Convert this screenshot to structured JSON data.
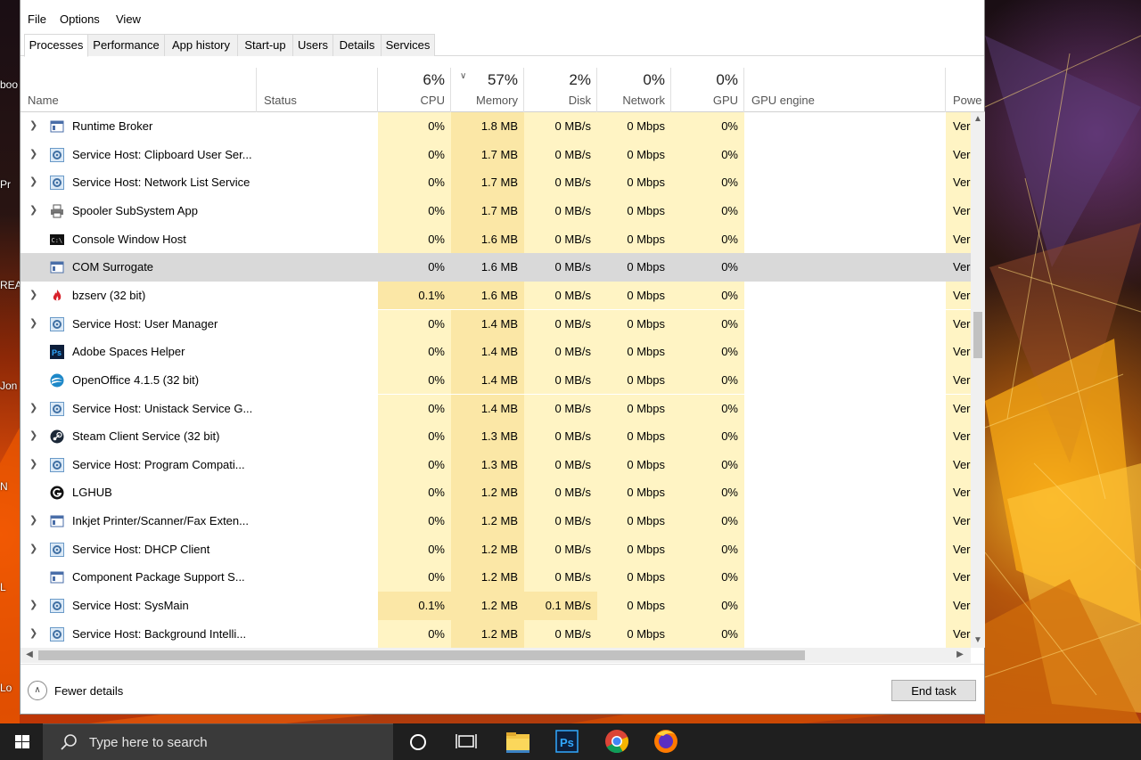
{
  "menu": [
    "File",
    "Options",
    "View"
  ],
  "tabs": [
    "Processes",
    "Performance",
    "App history",
    "Start-up",
    "Users",
    "Details",
    "Services"
  ],
  "header": {
    "name": "Name",
    "status": "Status",
    "cpu": {
      "pct": "6%",
      "label": "CPU"
    },
    "memory": {
      "pct": "57%",
      "label": "Memory"
    },
    "disk": {
      "pct": "2%",
      "label": "Disk"
    },
    "network": {
      "pct": "0%",
      "label": "Network"
    },
    "gpu": {
      "pct": "0%",
      "label": "GPU"
    },
    "gpu_engine": "GPU engine",
    "power": "Powe"
  },
  "processes": [
    {
      "name": "Runtime Broker",
      "icon": "window-icon",
      "expand": true,
      "cpu": "0%",
      "mem": "1.8 MB",
      "disk": "0 MB/s",
      "net": "0 Mbps",
      "gpu": "0%",
      "power": "Ver"
    },
    {
      "name": "Service Host: Clipboard User Ser...",
      "icon": "gear-icon",
      "expand": true,
      "cpu": "0%",
      "mem": "1.7 MB",
      "disk": "0 MB/s",
      "net": "0 Mbps",
      "gpu": "0%",
      "power": "Ver"
    },
    {
      "name": "Service Host: Network List Service",
      "icon": "gear-icon",
      "expand": true,
      "cpu": "0%",
      "mem": "1.7 MB",
      "disk": "0 MB/s",
      "net": "0 Mbps",
      "gpu": "0%",
      "power": "Ver"
    },
    {
      "name": "Spooler SubSystem App",
      "icon": "printer-icon",
      "expand": true,
      "cpu": "0%",
      "mem": "1.7 MB",
      "disk": "0 MB/s",
      "net": "0 Mbps",
      "gpu": "0%",
      "power": "Ver"
    },
    {
      "name": "Console Window Host",
      "icon": "console-icon",
      "expand": false,
      "cpu": "0%",
      "mem": "1.6 MB",
      "disk": "0 MB/s",
      "net": "0 Mbps",
      "gpu": "0%",
      "power": "Ver"
    },
    {
      "name": "COM Surrogate",
      "icon": "window-icon",
      "expand": false,
      "selected": true,
      "cpu": "0%",
      "mem": "1.6 MB",
      "disk": "0 MB/s",
      "net": "0 Mbps",
      "gpu": "0%",
      "power": "Ver"
    },
    {
      "name": "bzserv (32 bit)",
      "icon": "flame-icon",
      "expand": true,
      "cpu": "0.1%",
      "mem": "1.6 MB",
      "disk": "0 MB/s",
      "net": "0 Mbps",
      "gpu": "0%",
      "power": "Ver",
      "hot_cpu": true
    },
    {
      "name": "Service Host: User Manager",
      "icon": "gear-icon",
      "expand": true,
      "cpu": "0%",
      "mem": "1.4 MB",
      "disk": "0 MB/s",
      "net": "0 Mbps",
      "gpu": "0%",
      "power": "Ver"
    },
    {
      "name": "Adobe Spaces Helper",
      "icon": "photoshop-icon",
      "expand": false,
      "cpu": "0%",
      "mem": "1.4 MB",
      "disk": "0 MB/s",
      "net": "0 Mbps",
      "gpu": "0%",
      "power": "Ver"
    },
    {
      "name": "OpenOffice 4.1.5 (32 bit)",
      "icon": "openoffice-icon",
      "expand": false,
      "cpu": "0%",
      "mem": "1.4 MB",
      "disk": "0 MB/s",
      "net": "0 Mbps",
      "gpu": "0%",
      "power": "Ver"
    },
    {
      "name": "Service Host: Unistack Service G...",
      "icon": "gear-icon",
      "expand": true,
      "cpu": "0%",
      "mem": "1.4 MB",
      "disk": "0 MB/s",
      "net": "0 Mbps",
      "gpu": "0%",
      "power": "Ver"
    },
    {
      "name": "Steam Client Service (32 bit)",
      "icon": "steam-icon",
      "expand": true,
      "cpu": "0%",
      "mem": "1.3 MB",
      "disk": "0 MB/s",
      "net": "0 Mbps",
      "gpu": "0%",
      "power": "Ver"
    },
    {
      "name": "Service Host: Program Compati...",
      "icon": "gear-icon",
      "expand": true,
      "cpu": "0%",
      "mem": "1.3 MB",
      "disk": "0 MB/s",
      "net": "0 Mbps",
      "gpu": "0%",
      "power": "Ver"
    },
    {
      "name": "LGHUB",
      "icon": "lghub-icon",
      "expand": false,
      "cpu": "0%",
      "mem": "1.2 MB",
      "disk": "0 MB/s",
      "net": "0 Mbps",
      "gpu": "0%",
      "power": "Ver"
    },
    {
      "name": "Inkjet Printer/Scanner/Fax Exten...",
      "icon": "window-icon",
      "expand": true,
      "cpu": "0%",
      "mem": "1.2 MB",
      "disk": "0 MB/s",
      "net": "0 Mbps",
      "gpu": "0%",
      "power": "Ver"
    },
    {
      "name": "Service Host: DHCP Client",
      "icon": "gear-icon",
      "expand": true,
      "cpu": "0%",
      "mem": "1.2 MB",
      "disk": "0 MB/s",
      "net": "0 Mbps",
      "gpu": "0%",
      "power": "Ver"
    },
    {
      "name": "Component Package Support S...",
      "icon": "window-icon",
      "expand": false,
      "cpu": "0%",
      "mem": "1.2 MB",
      "disk": "0 MB/s",
      "net": "0 Mbps",
      "gpu": "0%",
      "power": "Ver"
    },
    {
      "name": "Service Host: SysMain",
      "icon": "gear-icon",
      "expand": true,
      "cpu": "0.1%",
      "mem": "1.2 MB",
      "disk": "0.1 MB/s",
      "net": "0 Mbps",
      "gpu": "0%",
      "power": "Ver",
      "hot_cpu": true,
      "hot_disk": true
    },
    {
      "name": "Service Host: Background Intelli...",
      "icon": "gear-icon",
      "expand": true,
      "cpu": "0%",
      "mem": "1.2 MB",
      "disk": "0 MB/s",
      "net": "0 Mbps",
      "gpu": "0%",
      "power": "Ver"
    }
  ],
  "footer": {
    "fewer_details": "Fewer details",
    "end_task": "End task"
  },
  "taskbar": {
    "search_placeholder": "Type here to search"
  },
  "desktop_labels": [
    "boo",
    "Pr",
    "REA",
    "Jon",
    "N",
    "L",
    "Lo"
  ]
}
